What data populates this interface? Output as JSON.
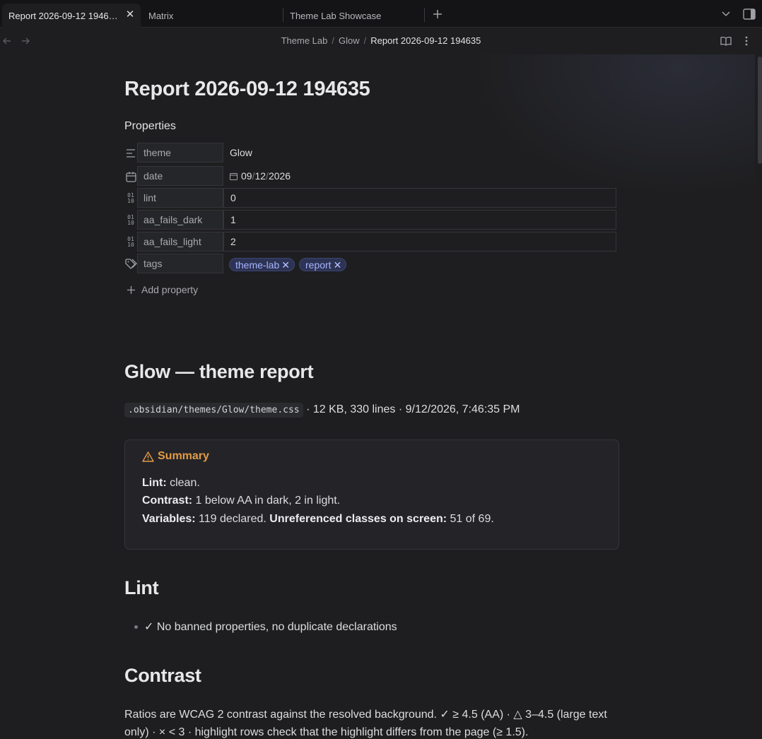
{
  "tabs": [
    {
      "label": "Report 2026-09-12 1946…",
      "active": true
    },
    {
      "label": "Matrix",
      "active": false
    },
    {
      "label": "Theme Lab Showcase",
      "active": false
    }
  ],
  "breadcrumb": {
    "items": [
      "Theme Lab",
      "Glow"
    ],
    "current": "Report 2026-09-12 194635",
    "separator": "/"
  },
  "note": {
    "title": "Report 2026-09-12 194635",
    "properties_heading": "Properties",
    "properties": [
      {
        "icon": "text-lines-icon",
        "key": "theme",
        "value": "Glow"
      },
      {
        "icon": "calendar-icon",
        "key": "date",
        "value": "09/12/2026",
        "date_parts": [
          "09",
          "12",
          "2026"
        ]
      },
      {
        "icon": "number-icon",
        "key": "lint",
        "value": "0"
      },
      {
        "icon": "number-icon",
        "key": "aa_fails_dark",
        "value": "1"
      },
      {
        "icon": "number-icon",
        "key": "aa_fails_light",
        "value": "2"
      },
      {
        "icon": "tags-icon",
        "key": "tags",
        "tags": [
          "theme-lab",
          "report"
        ]
      }
    ],
    "add_property_label": "Add property",
    "h2_report": "Glow — theme report",
    "meta": {
      "path": ".obsidian/themes/Glow/theme.css",
      "details": " · 12 KB, 330 lines · 9/12/2026, 7:46:35 PM"
    },
    "callout": {
      "title": "Summary",
      "lint_label": "Lint:",
      "lint_value": " clean.",
      "contrast_label": "Contrast:",
      "contrast_value": " 1 below AA in dark, 2 in light.",
      "variables_label": "Variables:",
      "variables_value": " 119 declared. ",
      "unref_label": "Unreferenced classes on screen:",
      "unref_value": " 51 of 69."
    },
    "h2_lint": "Lint",
    "lint_items": [
      "✓ No banned properties, no duplicate declarations"
    ],
    "h2_contrast": "Contrast",
    "contrast_para": "Ratios are WCAG 2 contrast against the resolved background. ✓ ≥ 4.5 (AA) · △ 3–4.5 (large text only) · × < 3 · highlight rows check that the highlight differs from the page (≥ 1.5)."
  },
  "colors": {
    "accent_tag": "#a7b4ff",
    "callout_warning": "#e39a45",
    "background": "#1e1e20"
  }
}
